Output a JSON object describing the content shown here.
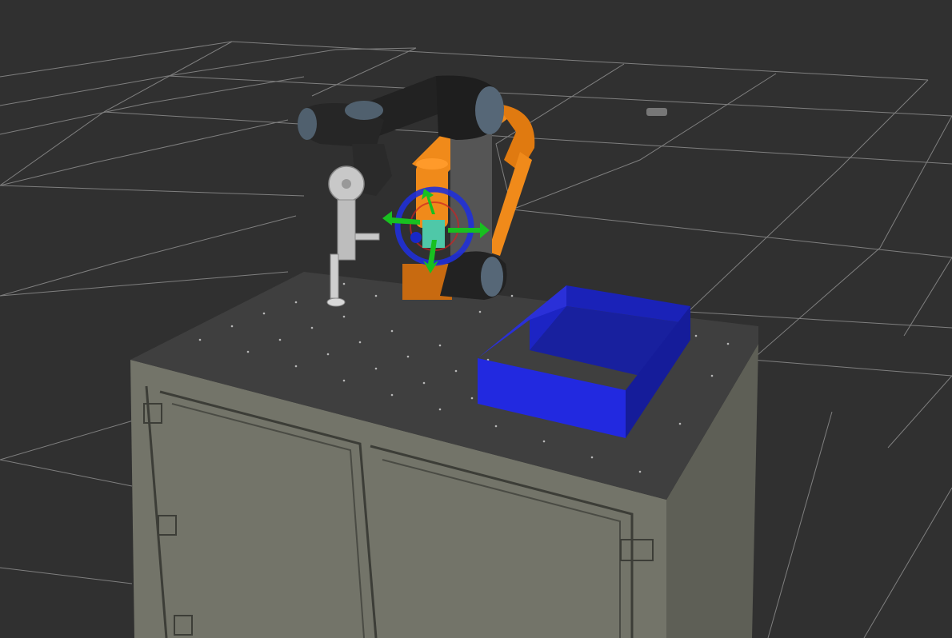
{
  "viewport": {
    "background_color": "#303030",
    "grid_color": "#a0a0a0",
    "grid_visible": true
  },
  "scene": {
    "objects": [
      {
        "name": "table",
        "color": "#737469"
      },
      {
        "name": "tabletop",
        "color": "#3f3f3f"
      },
      {
        "name": "blue-bin",
        "color": "#1f28d6"
      },
      {
        "name": "robot-arm-current",
        "color": "#2b2b2b",
        "joint_cap_color": "#50606e"
      },
      {
        "name": "robot-arm-goal",
        "color": "#f08a1a"
      },
      {
        "name": "gripper-tool",
        "color": "#c8c8c8"
      },
      {
        "name": "interactive-marker",
        "ring_color": "#2030d8",
        "x_arrow_color": "#18c020",
        "y_arrow_color": "#18c020"
      }
    ]
  }
}
